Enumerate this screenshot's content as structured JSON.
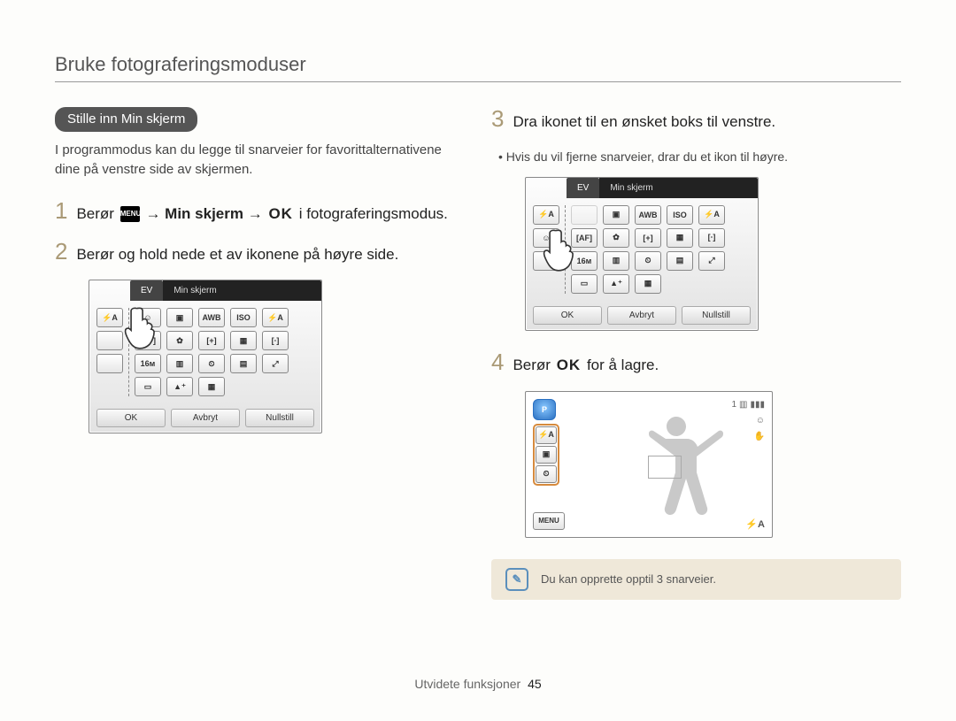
{
  "header": {
    "title": "Bruke fotograferingsmoduser"
  },
  "pill": "Stille inn Min skjerm",
  "intro": "I programmodus kan du legge til snarveier for favorittalternativene dine på venstre side av skjermen.",
  "steps": {
    "one": {
      "num": "1",
      "pre": "Berør",
      "menu_icon_title": "MENU",
      "arrow1": "→",
      "bold1": "Min skjerm",
      "arrow2": "→",
      "ok": "OK",
      "post": "i fotograferingsmodus."
    },
    "two": {
      "num": "2",
      "text": "Berør og hold nede et av ikonene på høyre side."
    },
    "three": {
      "num": "3",
      "text": "Dra ikonet til en ønsket boks til venstre."
    },
    "four": {
      "num": "4",
      "pre": "Berør",
      "ok": "OK",
      "post": "for å lagre."
    }
  },
  "bullet1": "Hvis du vil fjerne snarveier, drar du et ikon til høyre.",
  "device": {
    "tab": "EV",
    "title": "Min skjerm",
    "buttons": {
      "ok": "OK",
      "cancel": "Avbryt",
      "reset": "Nullstill"
    },
    "left_slot_label": "⚡A"
  },
  "preview": {
    "menu_label": "MENU",
    "top_right_count": "1",
    "bottom_right_label": "⚡A"
  },
  "note": "Du kan opprette opptil 3 snarveier.",
  "footer": {
    "section": "Utvidete funksjoner",
    "page": "45"
  }
}
